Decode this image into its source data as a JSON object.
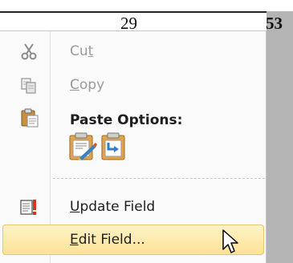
{
  "document": {
    "cell_value": "29",
    "highlighted_value": "53"
  },
  "menu": {
    "items": [
      {
        "label": "Cut",
        "pre": "Cu",
        "key": "t",
        "post": "",
        "icon": "scissors-icon",
        "enabled": false
      },
      {
        "label": "Copy",
        "pre": "",
        "key": "C",
        "post": "opy",
        "icon": "copy-icon",
        "enabled": false
      },
      {
        "label": "Update Field",
        "pre": "",
        "key": "U",
        "post": "pdate Field",
        "icon": "update-field-icon",
        "enabled": true
      },
      {
        "label": "Edit Field...",
        "pre": "",
        "key": "E",
        "post": "dit Field...",
        "icon": "edit-field-icon",
        "enabled": true,
        "highlighted": true
      }
    ],
    "paste_header": "Paste Options:",
    "paste_options": [
      {
        "icon": "paste-keep-formatting-icon"
      },
      {
        "icon": "paste-merge-formatting-icon"
      }
    ]
  },
  "colors": {
    "highlight_top": "#fdf2c7",
    "highlight_bottom": "#fde396",
    "highlight_border": "#e8c46b",
    "disabled_text": "#9a9a9a"
  }
}
